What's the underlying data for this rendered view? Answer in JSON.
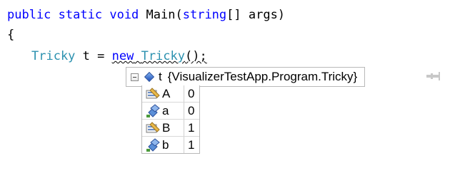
{
  "code": {
    "line1": {
      "kw1": "public",
      "kw2": "static",
      "kw3": "void",
      "name": "Main(",
      "kw4": "string",
      "rest": "[] args)"
    },
    "line2": "{",
    "line3": {
      "type1": "Tricky",
      "rest1": " t = ",
      "kw": "new",
      "type2": "Tricky",
      "rest2": "();"
    }
  },
  "datatip": {
    "variable": "t",
    "value": "{VisualizerTestApp.Program.Tricky}",
    "members": [
      {
        "name": "A",
        "value": "0",
        "icon": "property-icon"
      },
      {
        "name": "a",
        "value": "0",
        "icon": "field-icon"
      },
      {
        "name": "B",
        "value": "1",
        "icon": "property-icon"
      },
      {
        "name": "b",
        "value": "1",
        "icon": "field-icon"
      }
    ]
  }
}
